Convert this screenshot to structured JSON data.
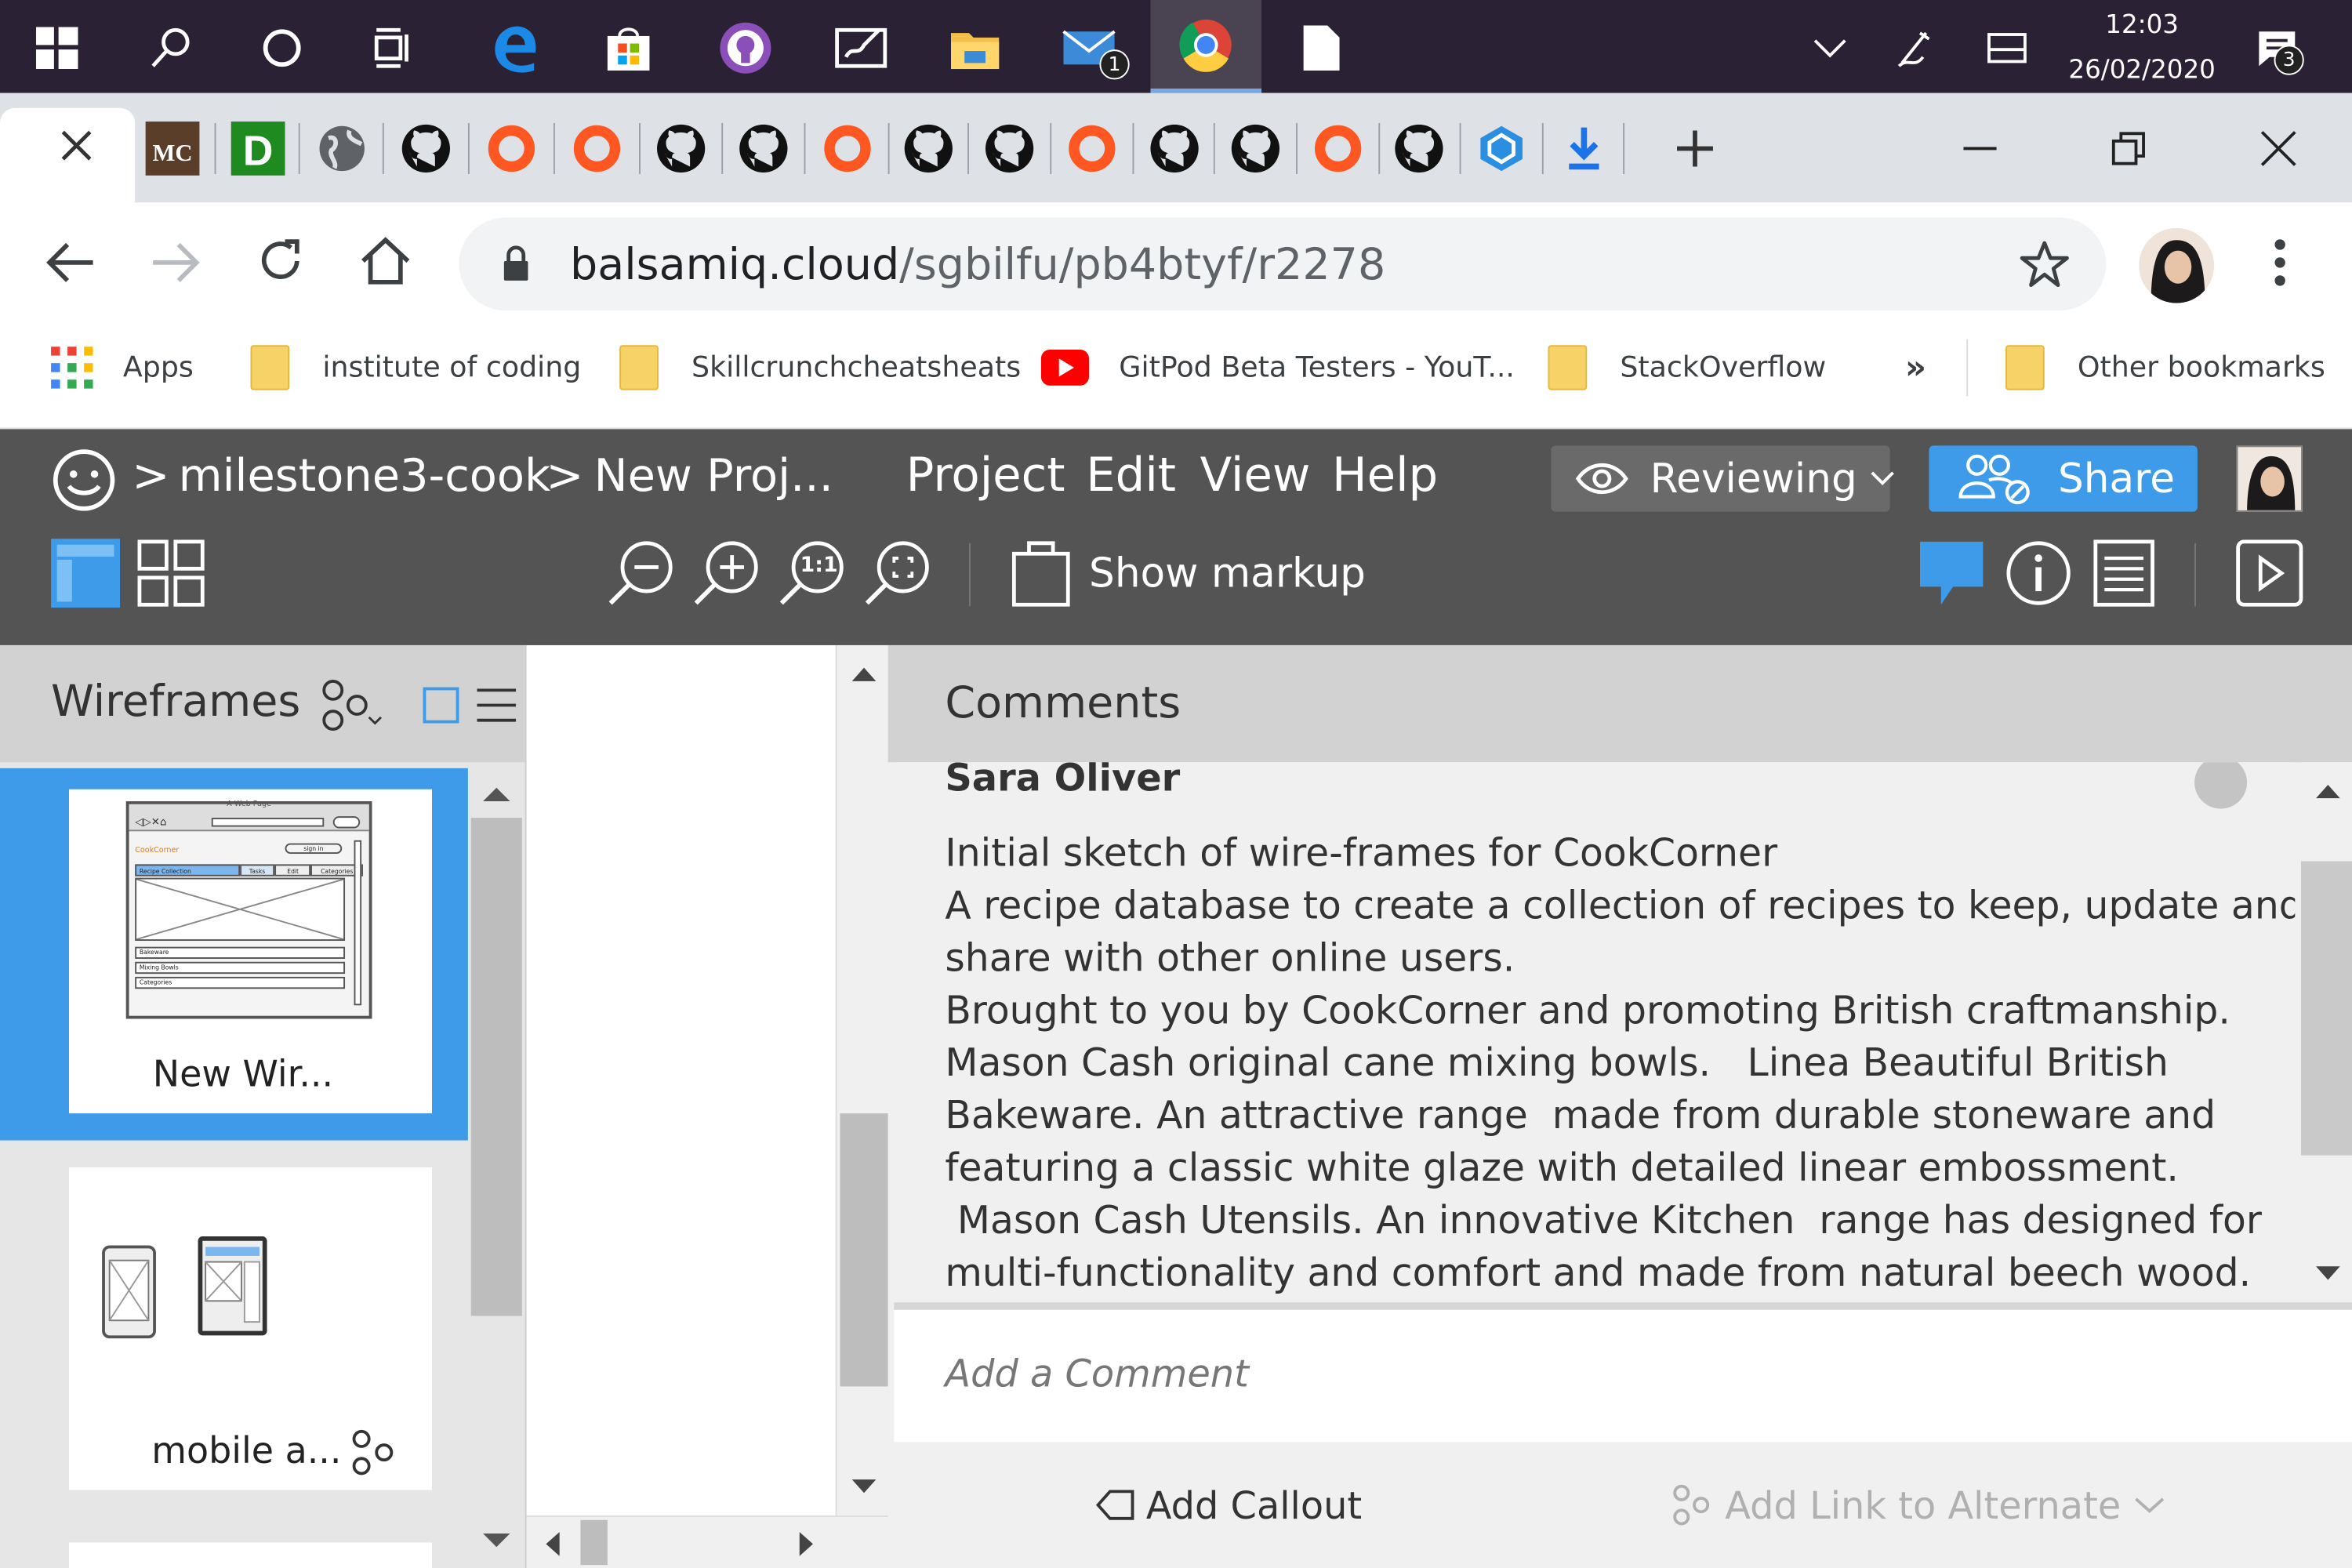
{
  "taskbar": {
    "time": "12:03",
    "date": "26/02/2020",
    "mail_badge": "1",
    "notification_badge": "3"
  },
  "browser": {
    "url_domain": "balsamiq.cloud",
    "url_path": "/sgbilfu/pb4btyf/r2278",
    "bookmarks": {
      "apps": "Apps",
      "items": [
        "institute of coding",
        "Skillcrunchcheatsheats",
        "GitPod Beta Testers - YouT...",
        "StackOverflow"
      ],
      "more": "»",
      "other": "Other bookmarks"
    }
  },
  "app": {
    "breadcrumb_sep": ">",
    "breadcrumb_1": "milestone3-cook",
    "breadcrumb_2": "New Proj...",
    "menu": [
      "Project",
      "Edit",
      "View",
      "Help"
    ],
    "mode_label": "Reviewing",
    "share_label": "Share",
    "show_markup_label": "Show markup",
    "zoom_actual_label": "1:1",
    "accent_color": "#3d9be9"
  },
  "sidebar": {
    "title": "Wireframes",
    "thumbnails": [
      {
        "label": "New Wir...",
        "selected": true,
        "mock_page_title": "A Web Page",
        "mock_brand": "CookCorner",
        "mock_signin": "sign in",
        "mock_tabs": [
          "Recipe Collection",
          "Tasks",
          "Edit",
          "Categories"
        ],
        "mock_list": [
          "Bakeware",
          "Mixing Bowls",
          "Categories"
        ]
      },
      {
        "label": "mobile a...",
        "selected": false
      }
    ]
  },
  "comments": {
    "title": "Comments",
    "author": "Sara Oliver",
    "lines": [
      "Initial sketch of wire-frames for CookCorner",
      "A recipe database to create a collection of recipes to keep, update and",
      "share with other online users.",
      "Brought to you by CookCorner and promoting British craftmanship.",
      "Mason Cash original cane mixing bowls.   Linea Beautiful British",
      "Bakeware. An attractive range  made from durable stoneware and",
      "featuring a classic white glaze with detailed linear embossment.",
      " Mason Cash Utensils. An innovative Kitchen  range has designed for",
      "multi-functionality and comfort and made from natural beech wood."
    ],
    "input_placeholder": "Add a Comment",
    "add_callout": "Add Callout",
    "add_link": "Add Link to Alternate"
  }
}
